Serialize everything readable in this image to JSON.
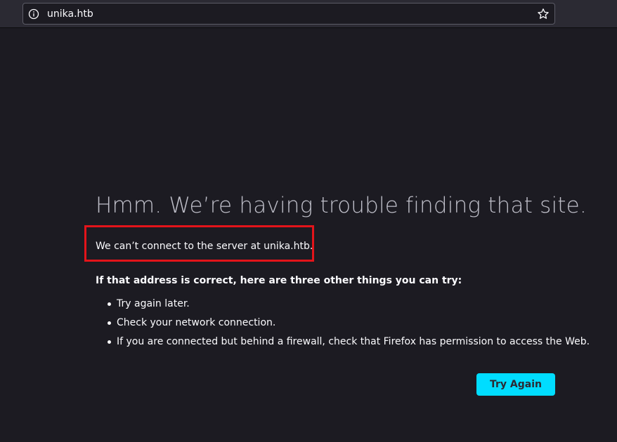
{
  "browser": {
    "url": "unika.htb",
    "info_icon": "info-circle-icon",
    "bookmark_icon": "star-outline-icon"
  },
  "error": {
    "title": "Hmm. We’re having trouble finding that site.",
    "short_desc": "We can’t connect to the server at unika.htb.",
    "advice_heading": "If that address is correct, here are three other things you can try:",
    "advice": [
      "Try again later.",
      "Check your network connection.",
      "If you are connected but behind a firewall, check that Firefox has permission to access the Web."
    ],
    "try_again_label": "Try Again"
  },
  "colors": {
    "background": "#1c1b22",
    "toolbar": "#2b2a33",
    "button_accent": "#00ddff",
    "highlight_box": "#e3141a"
  }
}
